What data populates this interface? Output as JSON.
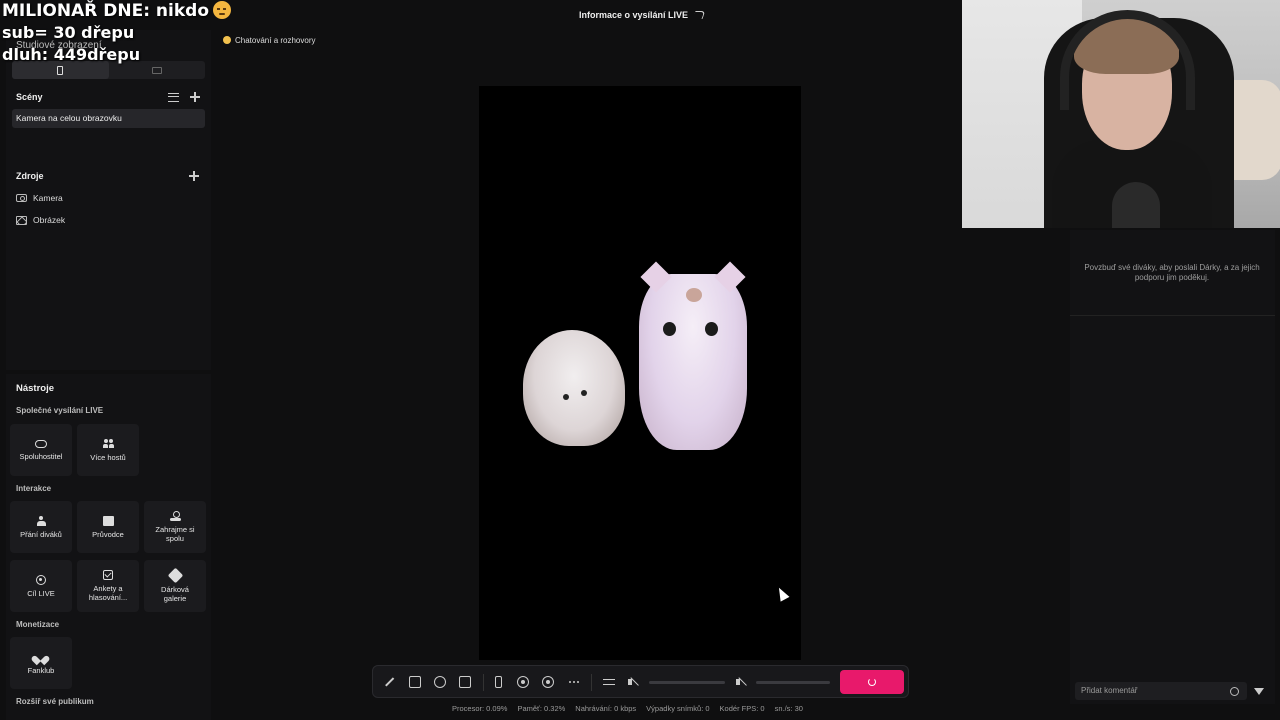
{
  "overlay": {
    "line1": "MILIONAŘ DNE: nikdo",
    "line2": "sub= 30 dřepu",
    "line3": "dluh: 449dřepu"
  },
  "sidebar": {
    "studio_view": "Studiové zobrazení",
    "scenes_title": "Scény",
    "scenes": [
      "Kamera na celou obrazovku"
    ],
    "sources_title": "Zdroje",
    "sources": [
      {
        "label": "Kamera",
        "icon": "camera-icon"
      },
      {
        "label": "Obrázek",
        "icon": "image-icon"
      }
    ]
  },
  "tools": {
    "title": "Nástroje",
    "group1": "Společné vysílání LIVE",
    "group1_items": [
      "Spoluhostitel",
      "Více hostů"
    ],
    "group2": "Interakce",
    "group2_items": [
      "Přání diváků",
      "Průvodce",
      "Zahrajme si spolu",
      "Cíl LIVE",
      "Ankety a hlasování...",
      "Dárková galerie"
    ],
    "group3": "Monetizace",
    "group3_items": [
      "Fanklub"
    ],
    "group4": "Rozšiř své publikum"
  },
  "topbar": {
    "chat_chip": "Chatování a rozhovory",
    "live_info": "Informace o vysílání LIVE"
  },
  "stats": {
    "cpu": "Procesor: 0.09%",
    "memory": "Paměť: 0.32%",
    "recording": "Nahrávání: 0 kbps",
    "dropped": "Výpadky snímků: 0",
    "encoder_fps": "Kodér FPS: 0",
    "fps": "sn./s: 30"
  },
  "right_panel": {
    "gift_message": "Povzbuď své diváky, aby poslali Dárky, a za jejich podporu jim poděkuj.",
    "comment_placeholder": "Přidat komentář"
  },
  "colors": {
    "accent": "#e8196b",
    "background": "#0f0f10",
    "panel": "#121214"
  }
}
